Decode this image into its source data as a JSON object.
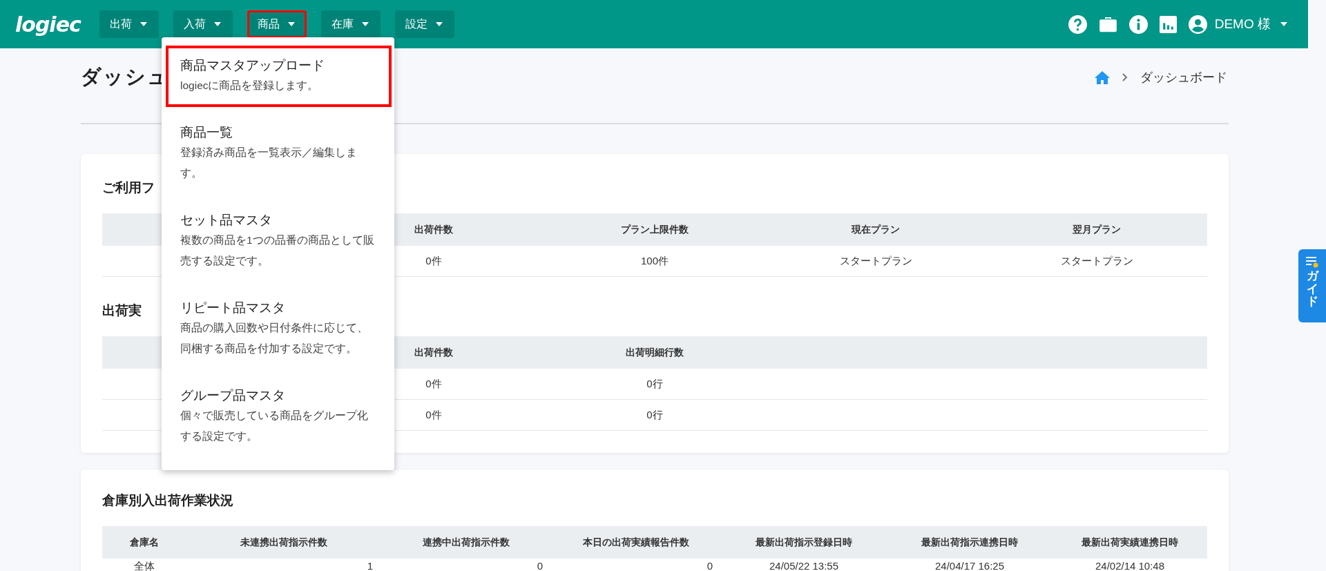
{
  "header": {
    "logo": "logiec",
    "nav": [
      {
        "label": "出荷",
        "highlighted": false
      },
      {
        "label": "入荷",
        "highlighted": false
      },
      {
        "label": "商品",
        "highlighted": true
      },
      {
        "label": "在庫",
        "highlighted": false
      },
      {
        "label": "設定",
        "highlighted": false
      }
    ],
    "user": "DEMO 様"
  },
  "dropdown": {
    "items": [
      {
        "title": "商品マスタアップロード",
        "description": "logiecに商品を登録します。",
        "highlighted": true
      },
      {
        "title": "商品一覧",
        "description": "登録済み商品を一覧表示／編集します。",
        "highlighted": false
      },
      {
        "title": "セット品マスタ",
        "description": "複数の商品を1つの品番の商品として販売する設定です。",
        "highlighted": false
      },
      {
        "title": "リピート品マスタ",
        "description": "商品の購入回数や日付条件に応じて、同梱する商品を付加する設定です。",
        "highlighted": false
      },
      {
        "title": "グループ品マスタ",
        "description": "個々で販売している商品をグループ化する設定です。",
        "highlighted": false
      }
    ]
  },
  "page": {
    "title": "ダッシュ",
    "breadcrumb": "ダッシュボード"
  },
  "cards": [
    {
      "kind": "summary",
      "sections": [
        {
          "title": "ご利用フ",
          "columns": [
            "出荷件数",
            "プラン上限件数",
            "現在プラン",
            "翌月プラン"
          ],
          "rows": [
            [
              "0件",
              "100件",
              "スタートプラン",
              "スタートプラン"
            ]
          ]
        },
        {
          "title": "出荷実",
          "columns": [
            "出荷件数",
            "出荷明細行数"
          ],
          "rows": [
            [
              "0件",
              "0行"
            ],
            [
              "0件",
              "0行"
            ]
          ]
        }
      ]
    },
    {
      "kind": "status",
      "sections": [
        {
          "title": "倉庫別入出荷作業状況",
          "columns": [
            "倉庫名",
            "未連携出荷指示件数",
            "連携中出荷指示件数",
            "本日の出荷実績報告件数",
            "最新出荷指示登録日時",
            "最新出荷指示連携日時",
            "最新出荷実績連携日時"
          ],
          "rows": [
            [
              "全体",
              "1",
              "0",
              "0",
              "24/05/22 13:55",
              "24/04/17 16:25",
              "24/02/14 10:48"
            ]
          ]
        }
      ]
    }
  ],
  "guide": {
    "label": "ガイド"
  }
}
